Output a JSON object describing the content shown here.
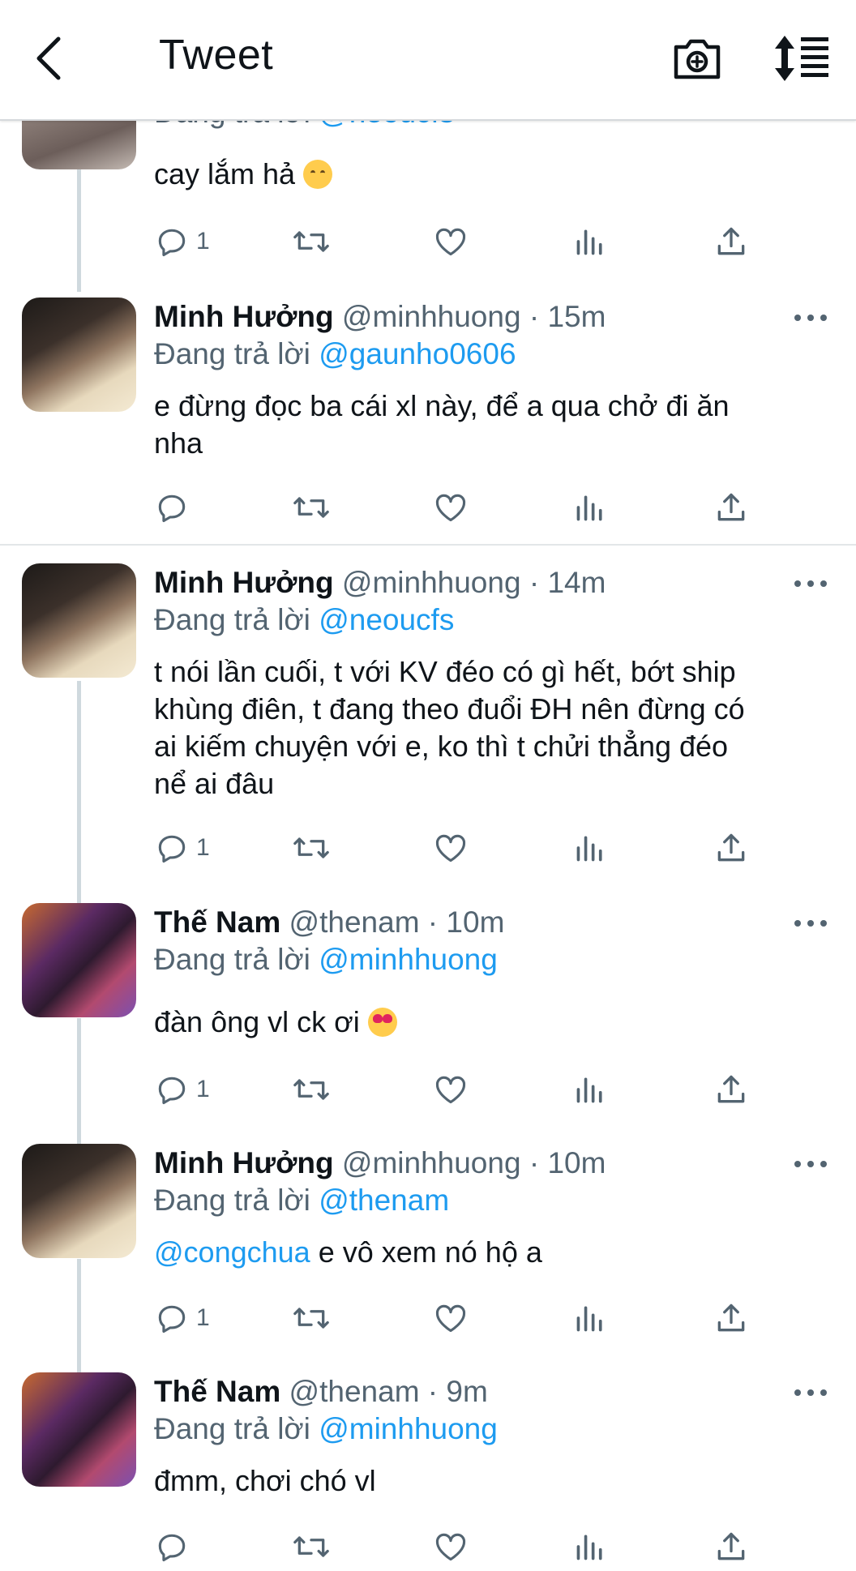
{
  "header": {
    "title": "Tweet",
    "back_icon": "chevron-left-icon",
    "camera_icon": "camera-plus-icon",
    "sort_icon": "sort-list-icon"
  },
  "colors": {
    "accent": "#1d9bf0",
    "secondary_text": "#536471",
    "thread_line": "#cfd9de"
  },
  "tweets": [
    {
      "name": "",
      "handle": "",
      "time": "",
      "reply_label": "Đang trả lời",
      "reply_to": "@neoucfs",
      "text": "cay lắm hả",
      "emoji": "smiling-face",
      "reply_count": "1"
    },
    {
      "name": "Minh Hưởng",
      "handle": "@minhhuong",
      "time": "15m",
      "reply_label": "Đang trả lời",
      "reply_to": "@gaunho0606",
      "text_line1": "e đừng đọc ba cái xl này, để a qua chở đi ăn",
      "text_line2": "nha",
      "reply_count": ""
    },
    {
      "name": "Minh Hưởng",
      "handle": "@minhhuong",
      "time": "14m",
      "reply_label": "Đang trả lời",
      "reply_to": "@neoucfs",
      "text_line1": "t nói lần cuối, t với KV đéo có gì hết, bớt ship",
      "text_line2": "khùng điên, t đang theo đuổi ĐH nên đừng có",
      "text_line3": "ai kiếm chuyện với e, ko thì t chửi thẳng đéo",
      "text_line4": "nể ai đâu",
      "reply_count": "1"
    },
    {
      "name": "Thế Nam",
      "handle": "@thenam",
      "time": "10m",
      "reply_label": "Đang trả lời",
      "reply_to": "@minhhuong",
      "text": "đàn ông vl ck ơi",
      "emoji": "heart-eyes-face",
      "reply_count": "1"
    },
    {
      "name": "Minh Hưởng",
      "handle": "@minhhuong",
      "time": "10m",
      "reply_label": "Đang trả lời",
      "reply_to": "@thenam",
      "mention": "@congchua",
      "text": "e vô xem nó hộ a",
      "reply_count": "1"
    },
    {
      "name": "Thế Nam",
      "handle": "@thenam",
      "time": "9m",
      "reply_label": "Đang trả lời",
      "reply_to": "@minhhuong",
      "text": "đmm, chơi chó vl"
    }
  ],
  "time_separator": " · "
}
